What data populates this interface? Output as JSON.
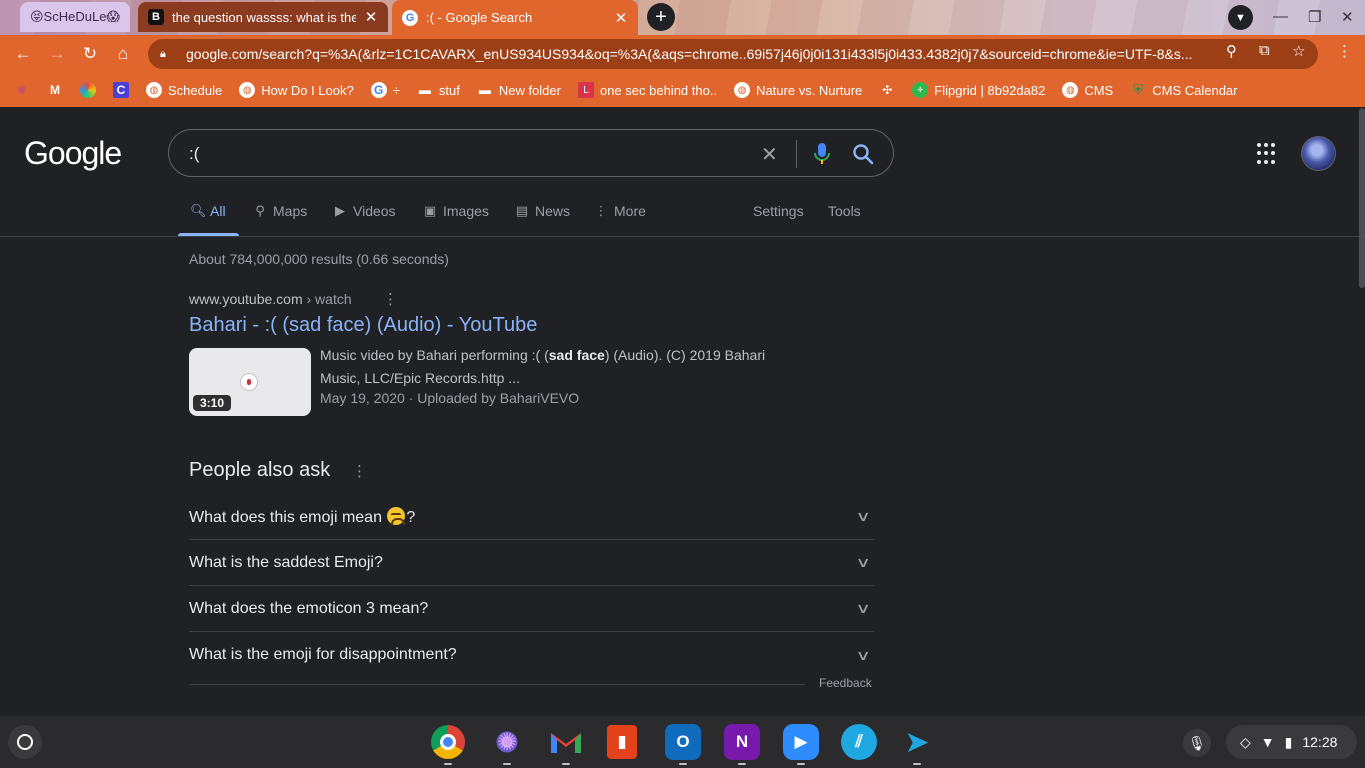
{
  "browser": {
    "tabs": [
      {
        "title": "😝ScHeDuLe😱"
      },
      {
        "title": "the question wassss: what is the"
      },
      {
        "title": ":( - Google Search"
      }
    ],
    "address": "google.com/search?q=%3A(&rlz=1C1CAVARX_enUS934US934&oq=%3A(&aqs=chrome..69i57j46j0j0i131i433l5j0i433.4382j0j7&sourceid=chrome&ie=UTF-8&s...",
    "bookmarks": [
      {
        "label": "",
        "icon": "flower-icon"
      },
      {
        "label": "",
        "icon": "gmail-icon"
      },
      {
        "label": "",
        "icon": "colorwheel-icon"
      },
      {
        "label": "",
        "icon": "c-icon"
      },
      {
        "label": "Schedule",
        "icon": "globe-icon"
      },
      {
        "label": "How Do I Look?",
        "icon": "globe-icon"
      },
      {
        "label": "÷",
        "icon": "google-icon"
      },
      {
        "label": "stuf",
        "icon": "folder-icon"
      },
      {
        "label": "New folder",
        "icon": "folder-icon"
      },
      {
        "label": "one sec behind tho..",
        "icon": "l-icon"
      },
      {
        "label": "Nature vs. Nurture",
        "icon": "globe-icon"
      },
      {
        "label": "",
        "icon": "puzzle-icon"
      },
      {
        "label": "Flipgrid | 8b92da82",
        "icon": "flipgrid-icon"
      },
      {
        "label": "CMS",
        "icon": "globe-icon"
      },
      {
        "label": "CMS Calendar",
        "icon": "shield-icon"
      }
    ]
  },
  "google": {
    "logo": "Google",
    "query": ":(",
    "nav": {
      "all": "All",
      "maps": "Maps",
      "videos": "Videos",
      "images": "Images",
      "news": "News",
      "more": "More",
      "settings": "Settings",
      "tools": "Tools"
    },
    "stats": "About 784,000,000 results (0.66 seconds)",
    "result": {
      "site": "www.youtube.com",
      "path": " › watch",
      "title": "Bahari - :( (sad face) (Audio) - YouTube",
      "duration": "3:10",
      "snippet_pre": "Music video by Bahari performing :( (",
      "snippet_bold": "sad face",
      "snippet_post": ") (Audio). (C) 2019 Bahari Music, LLC/Epic Records.http ...",
      "date": "May 19, 2020 · Uploaded by BahariVEVO"
    },
    "paa": {
      "title": "People also ask",
      "q1_pre": "What does this emoji mean ",
      "q1_post": "?",
      "q2": "What is the saddest Emoji?",
      "q3": "What does the emoticon 3 mean?",
      "q4": "What is the emoji for disappointment?"
    },
    "feedback": "Feedback"
  },
  "shelf": {
    "time": "12:28",
    "apps": [
      "chrome",
      "photos",
      "gmail",
      "office",
      "outlook",
      "onenote",
      "zoom",
      "screencastify",
      "pointer"
    ]
  }
}
